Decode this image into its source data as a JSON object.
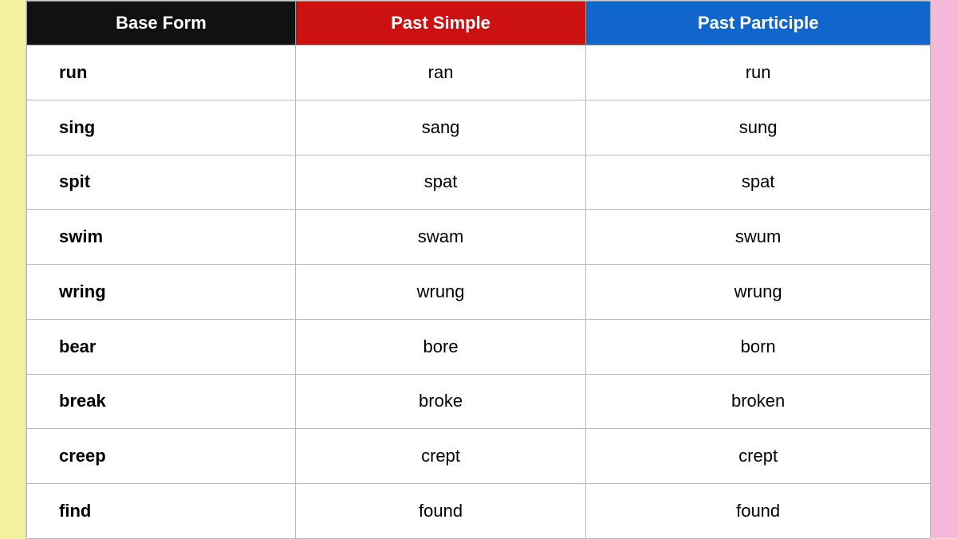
{
  "colors": {
    "left_bg": "#f5f0a0",
    "right_bg": "#f5b8d8",
    "header_base": "#111111",
    "header_past_simple": "#cc1111",
    "header_past_participle": "#1166cc"
  },
  "headers": {
    "base_form": "Base Form",
    "past_simple": "Past Simple",
    "past_participle": "Past Participle"
  },
  "rows": [
    {
      "base": "run",
      "past_simple": "ran",
      "past_participle": "run"
    },
    {
      "base": "sing",
      "past_simple": "sang",
      "past_participle": "sung"
    },
    {
      "base": "spit",
      "past_simple": "spat",
      "past_participle": "spat"
    },
    {
      "base": "swim",
      "past_simple": "swam",
      "past_participle": "swum"
    },
    {
      "base": "wring",
      "past_simple": "wrung",
      "past_participle": "wrung"
    },
    {
      "base": "bear",
      "past_simple": "bore",
      "past_participle": "born"
    },
    {
      "base": "break",
      "past_simple": "broke",
      "past_participle": "broken"
    },
    {
      "base": "creep",
      "past_simple": "crept",
      "past_participle": "crept"
    },
    {
      "base": "find",
      "past_simple": "found",
      "past_participle": "found"
    }
  ]
}
